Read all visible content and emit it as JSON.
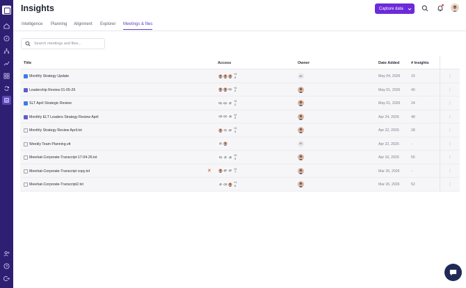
{
  "app": {
    "title": "Insights"
  },
  "header": {
    "capture_label": "Capture data"
  },
  "tabs": [
    {
      "label": "Intelligence"
    },
    {
      "label": "Planning"
    },
    {
      "label": "Alignment"
    },
    {
      "label": "Explorer"
    },
    {
      "label": "Meetings & files"
    }
  ],
  "active_tab": "Meetings & files",
  "search": {
    "placeholder": "Search meetings and files..."
  },
  "table": {
    "headers": {
      "title": "Title",
      "access": "Access",
      "owner": "Owner",
      "date": "Date Added",
      "insights": "# Insights"
    },
    "rows": [
      {
        "type": "video",
        "title": "Monthly Strategy Update",
        "access": [
          "img",
          "img",
          "img"
        ],
        "more": [
          "+2",
          "5"
        ],
        "owner": "JC",
        "owner_img": false,
        "date": "May 04, 2026",
        "insights": "15",
        "error": false
      },
      {
        "type": "teams",
        "title": "Leadership Review 01-05-26",
        "access": [
          "img",
          "img",
          "RC"
        ],
        "more": [
          "+2",
          "2"
        ],
        "owner": "",
        "owner_img": true,
        "date": "May 01, 2026",
        "insights": "40",
        "error": false
      },
      {
        "type": "video",
        "title": "SLT April Strategic Review",
        "access": [
          "RC",
          "DC",
          "JF"
        ],
        "more": [
          "+2",
          "2"
        ],
        "owner": "",
        "owner_img": true,
        "date": "May 01, 2026",
        "insights": "24",
        "error": false
      },
      {
        "type": "teams",
        "title": "Monthly ELT Leaders Strategy Review April",
        "access": [
          "CR",
          "DC",
          "JK"
        ],
        "more": [
          "+2",
          "3"
        ],
        "owner": "",
        "owner_img": true,
        "date": "Apr 24, 2026",
        "insights": "48",
        "error": false
      },
      {
        "type": "doc",
        "title": "Monthly Strategy Review April.txt",
        "access": [
          "img",
          "TV",
          "VF"
        ],
        "more": [
          "+2",
          "3"
        ],
        "owner": "",
        "owner_img": true,
        "date": "Apr 22, 2026",
        "insights": "28",
        "error": false
      },
      {
        "type": "doc",
        "title": "Weekly Team Planning.vtt",
        "access": [
          "JC",
          "img"
        ],
        "more": [],
        "owner": "JC",
        "owner_img": false,
        "date": "Apr 22, 2026",
        "insights": "-",
        "error": false
      },
      {
        "type": "doc",
        "title": "Meerkat-Corporate-Transcript-17-04-26.txt",
        "access": [
          "TK",
          "JF",
          "JK"
        ],
        "more": [
          "+2",
          "3"
        ],
        "owner": "",
        "owner_img": true,
        "date": "Apr 16, 2026",
        "insights": "55",
        "error": false
      },
      {
        "type": "doc",
        "title": "Meerkat-Corporate-Transcript copy.txt",
        "access": [
          "img",
          "DF",
          "VF"
        ],
        "more": [
          "+2",
          "7"
        ],
        "owner": "",
        "owner_img": true,
        "date": "Mar 26, 2026",
        "insights": "-",
        "error": true
      },
      {
        "type": "doc",
        "title": "Meerkat-Corporate-Transcript2.txt",
        "access": [
          "JF",
          "CR",
          "img"
        ],
        "more": [
          "+1",
          "6"
        ],
        "owner": "",
        "owner_img": true,
        "date": "Mar 26, 2026",
        "insights": "52",
        "error": false
      }
    ]
  },
  "colors": {
    "rail": "#2e1f73",
    "accent": "#6c2bd9",
    "tab_active": "#5e3ccc",
    "error": "#d93a2b",
    "chat": "#1f2a56"
  }
}
